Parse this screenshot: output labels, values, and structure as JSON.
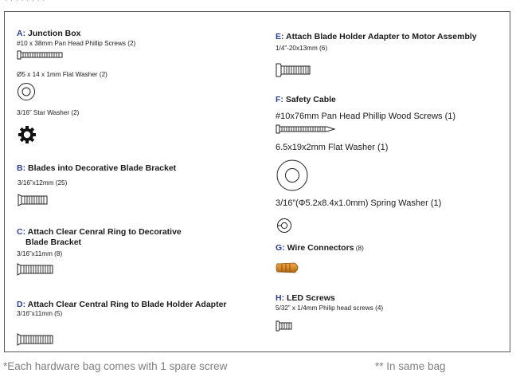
{
  "top_partial": "· · · · · · · ·",
  "sections": {
    "A": {
      "letter": "A:",
      "title": "Junction Box",
      "items": [
        "#10 x 38mm Pan Head Phillip Screws (2)",
        "Ø5 x 14 x 1mm Flat Washer (2)",
        "3/16” Star Washer (2)"
      ]
    },
    "B": {
      "letter": "B:",
      "title": "Blades into Decorative Blade Bracket",
      "items": [
        "3/16”x12mm  (25)"
      ]
    },
    "C": {
      "letter": "C:",
      "title_line1": "Attach Clear Cenral Ring to Decorative",
      "title_line2": "Blade Bracket",
      "items": [
        "3/16”x11mm (8)"
      ]
    },
    "D": {
      "letter": "D:",
      "title": "Attach Clear Central Ring to Blade Holder Adapter",
      "items": [
        "3/16”x11mm (5)"
      ]
    },
    "E": {
      "letter": "E:",
      "title": "Attach Blade Holder Adapter to Motor Assembly",
      "items": [
        "1/4”-20x13mm (6)"
      ]
    },
    "F": {
      "letter": "F:",
      "title": "Safety Cable",
      "items": [
        "#10x76mm Pan Head Phillip Wood Screws (1)",
        "6.5x19x2mm Flat Washer (1)",
        "3/16”(Φ5.2x8.4x1.0mm) Spring Washer (1)"
      ]
    },
    "G": {
      "letter": "G:",
      "title": "Wire Connectors",
      "count": " (8)"
    },
    "H": {
      "letter": "H:",
      "title": "LED Screws",
      "items": [
        "5/32” x 1/4mm Philip head screws (4)"
      ]
    }
  },
  "footer": {
    "left": "*Each hardware bag comes with 1 spare screw",
    "right": "** In same bag"
  }
}
